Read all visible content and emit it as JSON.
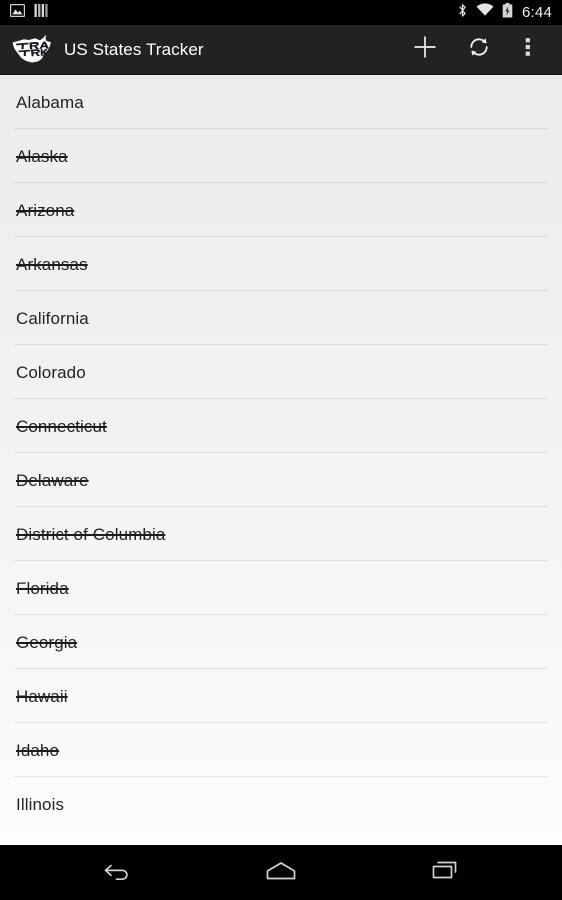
{
  "status_bar": {
    "left_icons": [
      "screenshot-image-icon",
      "vertical-bars-icon"
    ],
    "right_icons": [
      "bluetooth-icon",
      "wifi-icon",
      "battery-charging-icon"
    ],
    "clock": "6:44"
  },
  "action_bar": {
    "logo_icon": "us-map-track-logo-icon",
    "title": "US States Tracker",
    "actions": [
      {
        "name": "add-button",
        "icon": "plus-icon"
      },
      {
        "name": "refresh-button",
        "icon": "refresh-sync-icon"
      },
      {
        "name": "overflow-menu-button",
        "icon": "overflow-dots-icon"
      }
    ]
  },
  "list": {
    "items": [
      {
        "name": "Alabama",
        "visited": false
      },
      {
        "name": "Alaska",
        "visited": true
      },
      {
        "name": "Arizona",
        "visited": true
      },
      {
        "name": "Arkansas",
        "visited": true
      },
      {
        "name": "California",
        "visited": false
      },
      {
        "name": "Colorado",
        "visited": false
      },
      {
        "name": "Connecticut",
        "visited": true
      },
      {
        "name": "Delaware",
        "visited": true
      },
      {
        "name": "District of Columbia",
        "visited": true
      },
      {
        "name": "Florida",
        "visited": true
      },
      {
        "name": "Georgia",
        "visited": true
      },
      {
        "name": "Hawaii",
        "visited": true
      },
      {
        "name": "Idaho",
        "visited": true
      },
      {
        "name": "Illinois",
        "visited": false
      }
    ]
  },
  "nav_bar": {
    "buttons": [
      {
        "name": "back-button",
        "icon": "back-arrow-icon"
      },
      {
        "name": "home-button",
        "icon": "home-icon"
      },
      {
        "name": "recents-button",
        "icon": "recents-icon"
      }
    ]
  },
  "colors": {
    "status_bar_bg": "#000000",
    "action_bar_bg": "#222222",
    "list_bg_top": "#ececec",
    "list_bg_bottom": "#fdfdfd",
    "text_primary": "#232323",
    "action_bar_text": "#ffffff",
    "divider": "rgba(0,0,0,0.085)"
  }
}
